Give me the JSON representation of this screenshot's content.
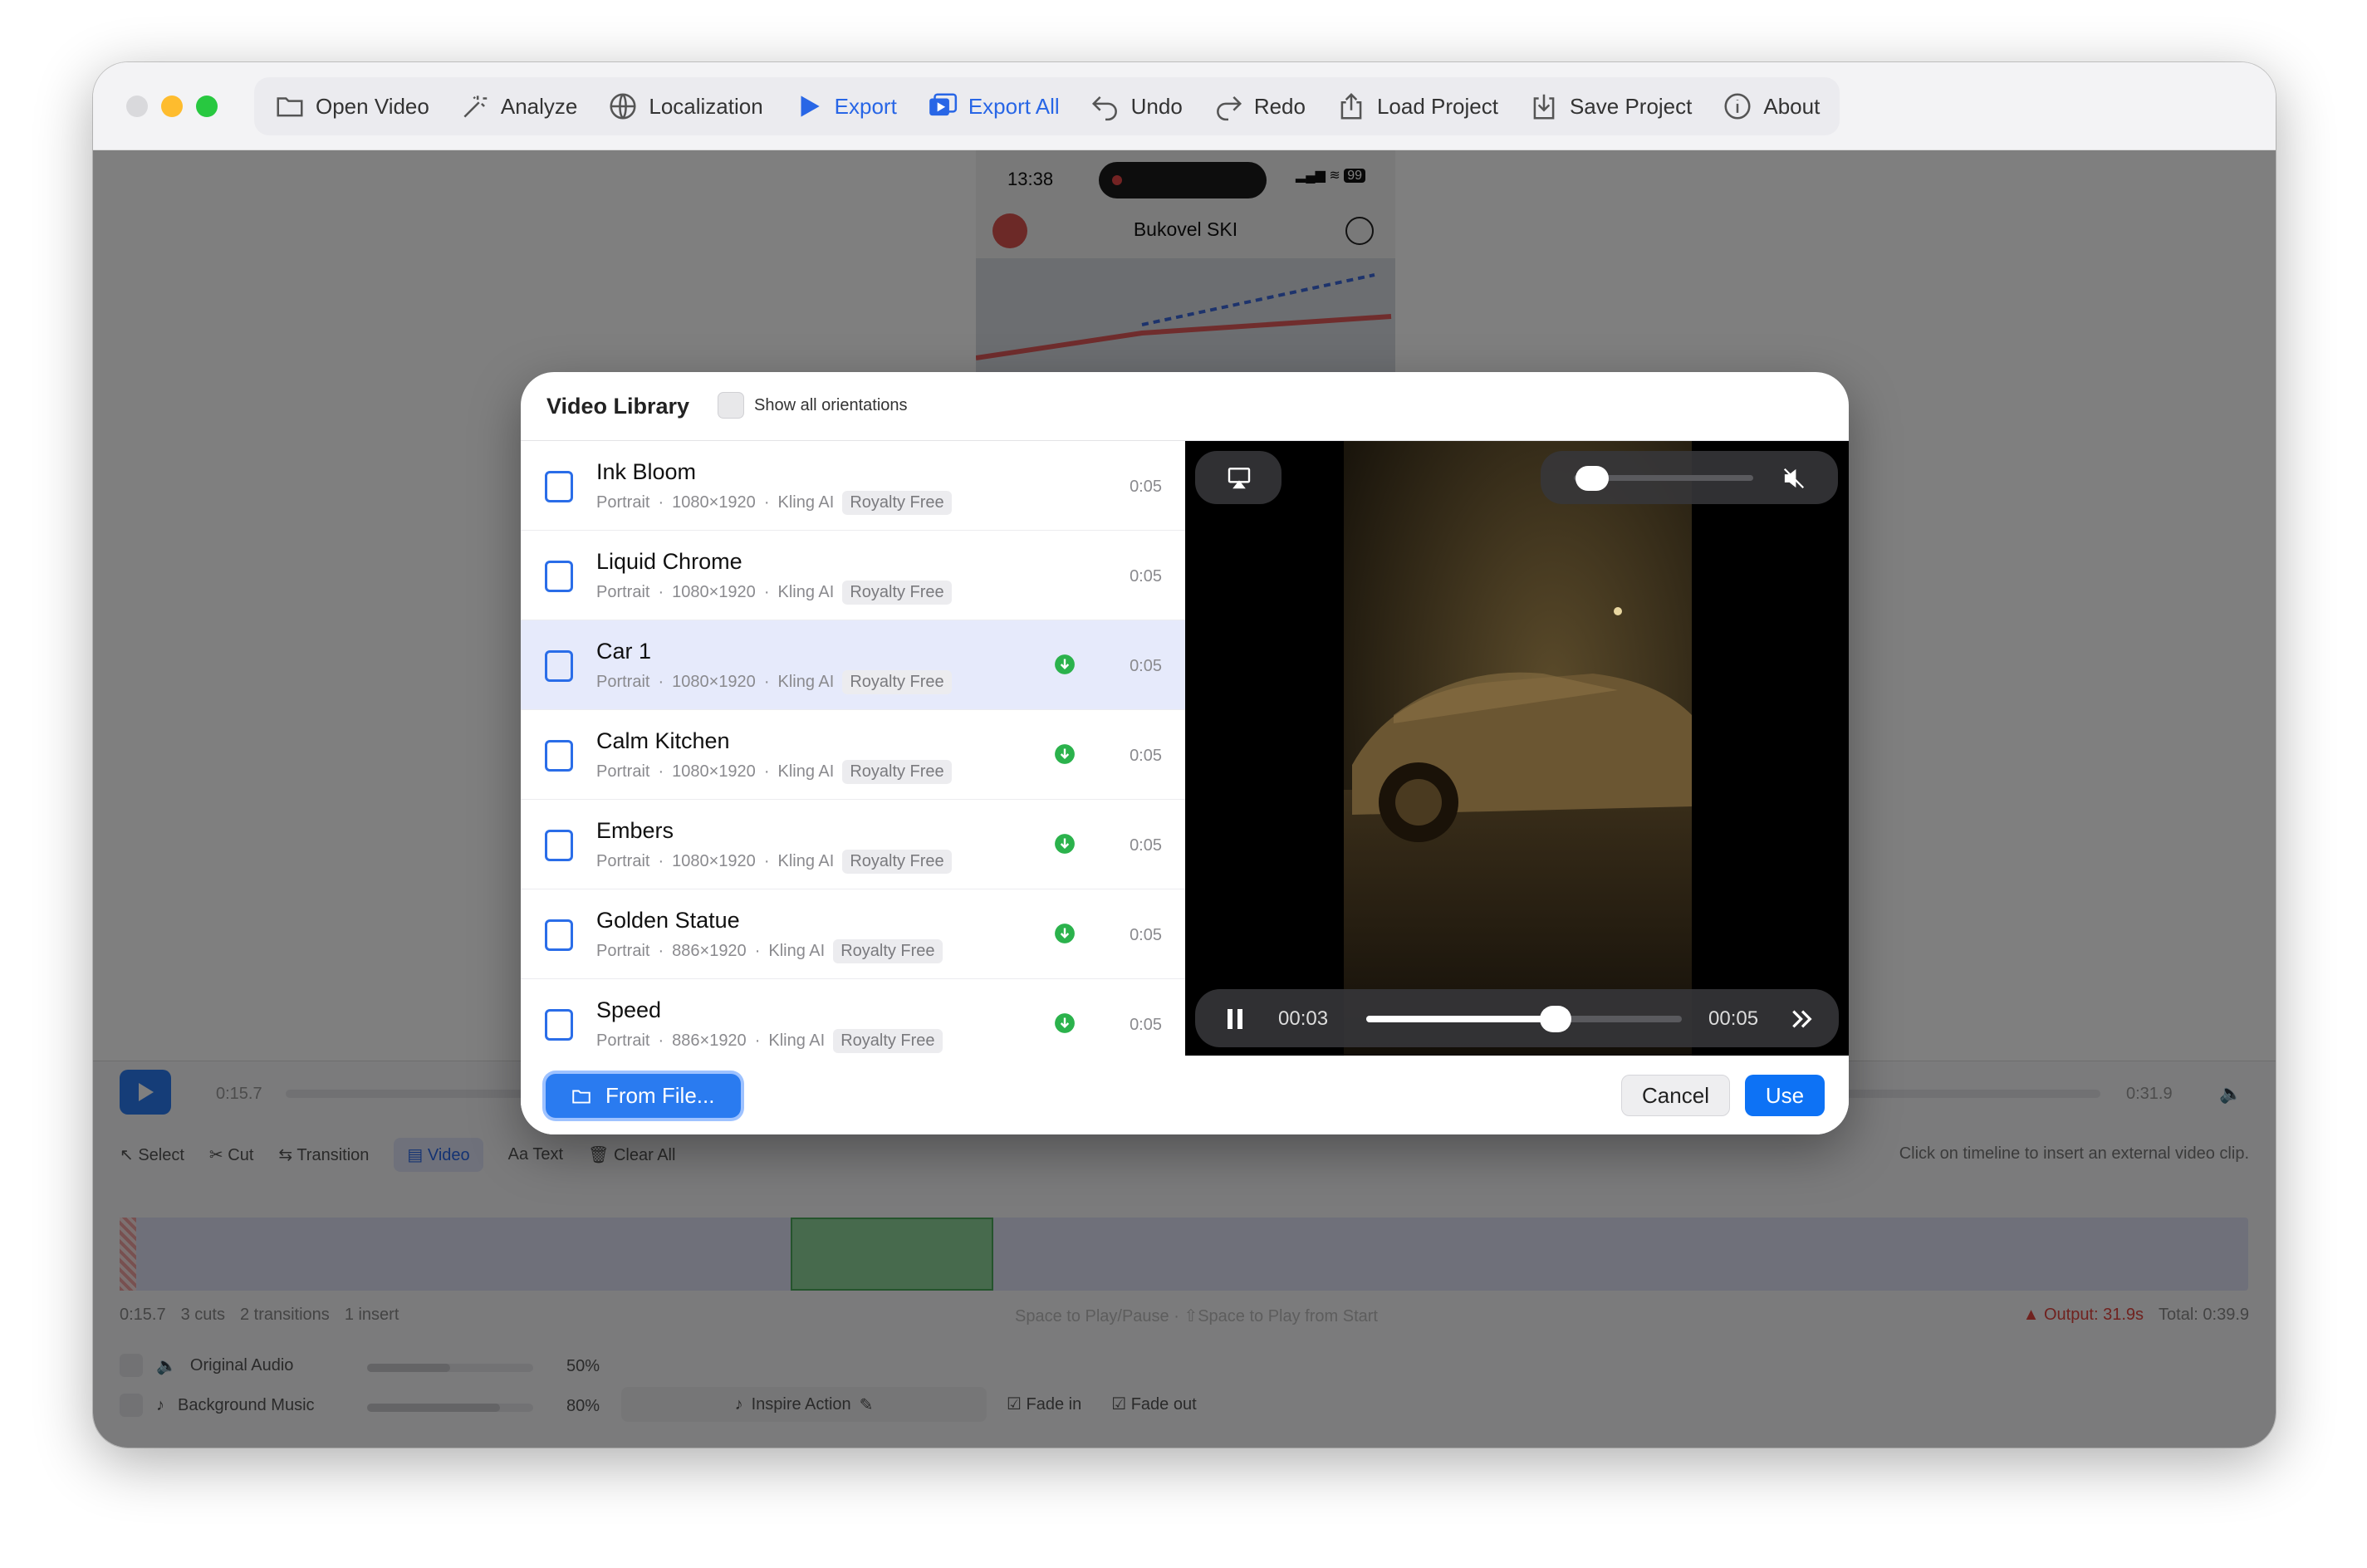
{
  "toolbar": {
    "items": [
      {
        "label": "Open Video",
        "icon": "folder-icon"
      },
      {
        "label": "Analyze",
        "icon": "magic-wand-icon"
      },
      {
        "label": "Localization",
        "icon": "globe-icon"
      },
      {
        "label": "Export",
        "icon": "play-triangle-icon"
      },
      {
        "label": "Export All",
        "icon": "export-all-icon"
      },
      {
        "label": "Undo",
        "icon": "undo-icon"
      },
      {
        "label": "Redo",
        "icon": "redo-icon"
      },
      {
        "label": "Load Project",
        "icon": "upload-icon"
      },
      {
        "label": "Save Project",
        "icon": "download-icon"
      },
      {
        "label": "About",
        "icon": "info-icon"
      }
    ]
  },
  "phone": {
    "time": "13:38",
    "battery": "99",
    "title": "Bukovel SKI"
  },
  "playback": {
    "current": "0:15.7",
    "total": "0:31.9"
  },
  "edit_tools": {
    "select": "Select",
    "cut": "Cut",
    "transition": "Transition",
    "video": "Video",
    "text": "Text",
    "clear_all": "Clear All",
    "hint": "Click on timeline to insert an external video clip."
  },
  "timeline_status": {
    "time": "0:15.7",
    "cuts": "3 cuts",
    "transitions": "2 transitions",
    "inserts": "1 insert",
    "shortcuts": "Space to Play/Pause · ⇧Space to Play from Start",
    "output": "Output: 31.9s",
    "total": "Total: 0:39.9"
  },
  "audio": {
    "original_label": "Original Audio",
    "original_pct": "50%",
    "original_level": 0.5,
    "music_label": "Background Music",
    "music_pct": "80%",
    "music_level": 0.8,
    "track": "Inspire Action",
    "fade_in": "Fade in",
    "fade_out": "Fade out"
  },
  "dialog": {
    "title": "Video Library",
    "show_all_label": "Show all orientations",
    "items": [
      {
        "name": "Ink Bloom",
        "orientation": "Portrait",
        "res": "1080×1920",
        "source": "Kling AI",
        "license": "Royalty Free",
        "duration": "0:05",
        "downloaded": false
      },
      {
        "name": "Liquid Chrome",
        "orientation": "Portrait",
        "res": "1080×1920",
        "source": "Kling AI",
        "license": "Royalty Free",
        "duration": "0:05",
        "downloaded": false
      },
      {
        "name": "Car 1",
        "orientation": "Portrait",
        "res": "1080×1920",
        "source": "Kling AI",
        "license": "Royalty Free",
        "duration": "0:05",
        "downloaded": true
      },
      {
        "name": "Calm Kitchen",
        "orientation": "Portrait",
        "res": "1080×1920",
        "source": "Kling AI",
        "license": "Royalty Free",
        "duration": "0:05",
        "downloaded": true
      },
      {
        "name": "Embers",
        "orientation": "Portrait",
        "res": "1080×1920",
        "source": "Kling AI",
        "license": "Royalty Free",
        "duration": "0:05",
        "downloaded": true
      },
      {
        "name": "Golden Statue",
        "orientation": "Portrait",
        "res": "886×1920",
        "source": "Kling AI",
        "license": "Royalty Free",
        "duration": "0:05",
        "downloaded": true
      },
      {
        "name": "Speed",
        "orientation": "Portrait",
        "res": "886×1920",
        "source": "Kling AI",
        "license": "Royalty Free",
        "duration": "0:05",
        "downloaded": true
      }
    ],
    "player": {
      "current": "00:03",
      "duration": "00:05",
      "progress": 0.6,
      "volume": 0.1
    },
    "from_file": "From File...",
    "cancel": "Cancel",
    "use": "Use"
  },
  "colors": {
    "accent": "#0d72f5",
    "export_blue": "#2866e6",
    "download_green": "#2bb24c",
    "selected_row": "#e6eafb"
  }
}
